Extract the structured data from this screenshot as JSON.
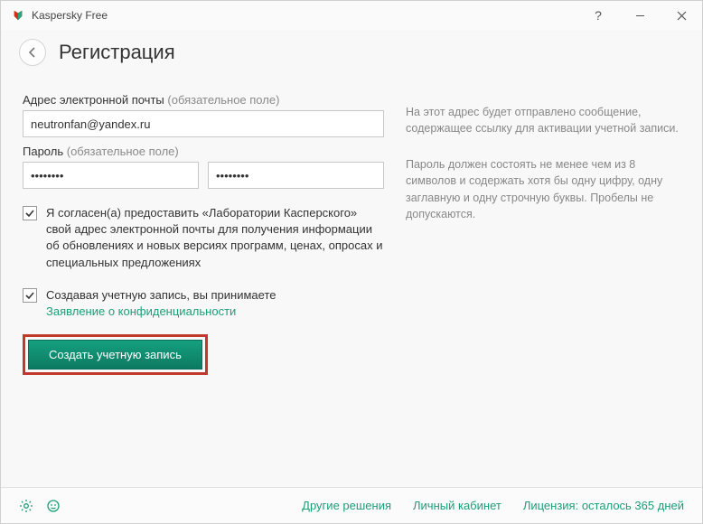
{
  "titlebar": {
    "app_name": "Kaspersky Free"
  },
  "header": {
    "page_title": "Регистрация"
  },
  "form": {
    "email_label": "Адрес электронной почты",
    "email_required": "(обязательное поле)",
    "email_value": "neutronfan@yandex.ru",
    "password_label": "Пароль",
    "password_required": "(обязательное поле)",
    "password_value": "••••••••",
    "password_confirm_value": "••••••••",
    "consent_text": "Я согласен(а) предоставить «Лаборатории Касперского» свой адрес электронной почты для получения информации об обновлениях и новых версиях программ, ценах, опросах и специальных предложениях",
    "terms_text_prefix": "Создавая учетную запись, вы принимаете",
    "terms_link": "Заявление о конфиденциальности",
    "submit_label": "Создать учетную запись"
  },
  "hints": {
    "email_hint": "На этот адрес будет отправлено сообщение, содержащее ссылку для активации учетной записи.",
    "password_hint": "Пароль должен состоять не менее чем из 8 символов и содержать хотя бы одну цифру, одну заглавную и одну строчную буквы. Пробелы не допускаются."
  },
  "footer": {
    "link_solutions": "Другие решения",
    "link_account": "Личный кабинет",
    "link_license": "Лицензия: осталось 365 дней"
  }
}
